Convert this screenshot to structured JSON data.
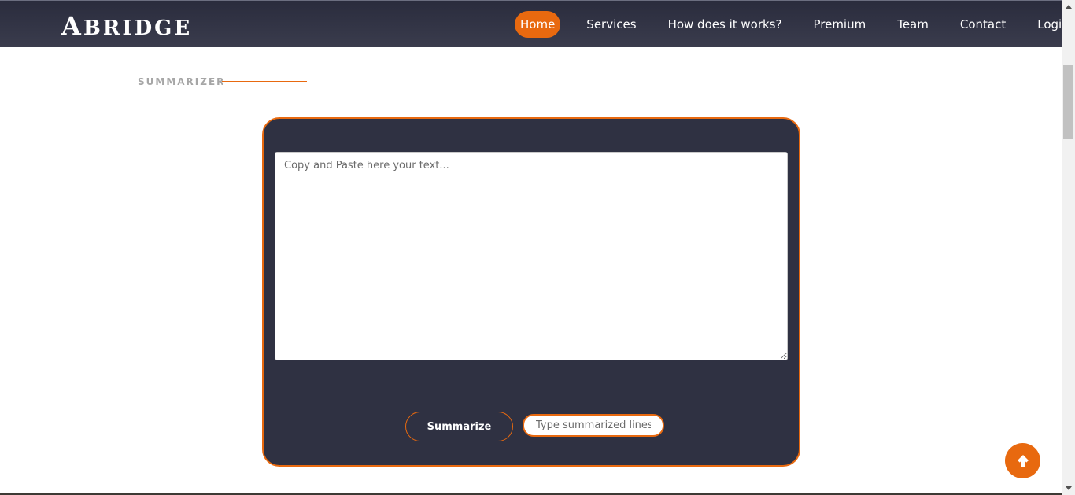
{
  "brand": {
    "first_letter": "A",
    "rest": "BRIDGE"
  },
  "nav": {
    "items": [
      {
        "label": "Home",
        "active": true
      },
      {
        "label": "Services"
      },
      {
        "label": "How does it works?"
      },
      {
        "label": "Premium"
      },
      {
        "label": "Team"
      },
      {
        "label": "Contact"
      },
      {
        "label": "Login"
      }
    ]
  },
  "section": {
    "title": "SUMMARIZER"
  },
  "summarizer": {
    "textarea_placeholder": "Copy and Paste here your text...",
    "textarea_value": "",
    "button_label": "Summarize",
    "lines_placeholder": "Type summarized lines",
    "lines_value": ""
  },
  "icons": {
    "back_to_top": "arrow-up-icon",
    "scroll_up": "triangle-up-icon",
    "scroll_down": "triangle-down-icon"
  },
  "colors": {
    "accent": "#e8690f",
    "navbar": "#2f3142",
    "card": "#2f3142"
  }
}
